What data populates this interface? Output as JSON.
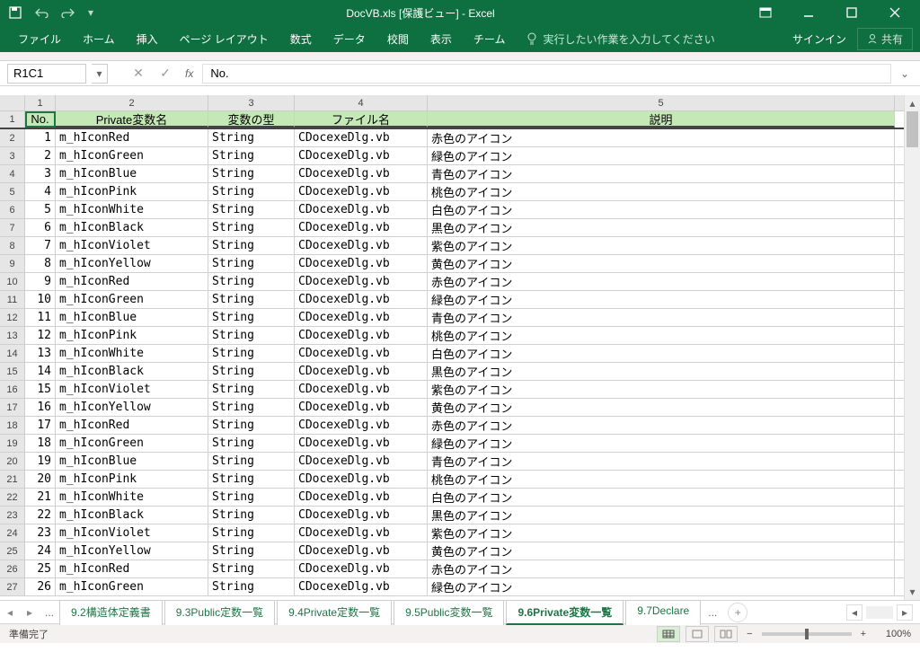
{
  "title_bar": {
    "app_title": "DocVB.xls  [保護ビュー] - Excel",
    "sign_in": "サインイン",
    "share": "共有"
  },
  "ribbon": {
    "tabs": [
      "ファイル",
      "ホーム",
      "挿入",
      "ページ レイアウト",
      "数式",
      "データ",
      "校閲",
      "表示",
      "チーム"
    ],
    "tell_me": "実行したい作業を入力してください"
  },
  "formula_bar": {
    "name_box": "R1C1",
    "formula": "No."
  },
  "grid": {
    "col_numbers": [
      "1",
      "2",
      "3",
      "4",
      "5"
    ],
    "headers": [
      "No.",
      "Private変数名",
      "変数の型",
      "ファイル名",
      "説明"
    ],
    "rows": [
      {
        "no": "1",
        "name": "m_hIconRed",
        "type": "String",
        "file": "CDocexeDlg.vb",
        "desc": "赤色のアイコン"
      },
      {
        "no": "2",
        "name": "m_hIconGreen",
        "type": "String",
        "file": "CDocexeDlg.vb",
        "desc": "緑色のアイコン"
      },
      {
        "no": "3",
        "name": "m_hIconBlue",
        "type": "String",
        "file": "CDocexeDlg.vb",
        "desc": "青色のアイコン"
      },
      {
        "no": "4",
        "name": "m_hIconPink",
        "type": "String",
        "file": "CDocexeDlg.vb",
        "desc": "桃色のアイコン"
      },
      {
        "no": "5",
        "name": "m_hIconWhite",
        "type": "String",
        "file": "CDocexeDlg.vb",
        "desc": "白色のアイコン"
      },
      {
        "no": "6",
        "name": "m_hIconBlack",
        "type": "String",
        "file": "CDocexeDlg.vb",
        "desc": "黒色のアイコン"
      },
      {
        "no": "7",
        "name": "m_hIconViolet",
        "type": "String",
        "file": "CDocexeDlg.vb",
        "desc": "紫色のアイコン"
      },
      {
        "no": "8",
        "name": "m_hIconYellow",
        "type": "String",
        "file": "CDocexeDlg.vb",
        "desc": "黄色のアイコン"
      },
      {
        "no": "9",
        "name": "m_hIconRed",
        "type": "String",
        "file": "CDocexeDlg.vb",
        "desc": "赤色のアイコン"
      },
      {
        "no": "10",
        "name": "m_hIconGreen",
        "type": "String",
        "file": "CDocexeDlg.vb",
        "desc": "緑色のアイコン"
      },
      {
        "no": "11",
        "name": "m_hIconBlue",
        "type": "String",
        "file": "CDocexeDlg.vb",
        "desc": "青色のアイコン"
      },
      {
        "no": "12",
        "name": "m_hIconPink",
        "type": "String",
        "file": "CDocexeDlg.vb",
        "desc": "桃色のアイコン"
      },
      {
        "no": "13",
        "name": "m_hIconWhite",
        "type": "String",
        "file": "CDocexeDlg.vb",
        "desc": "白色のアイコン"
      },
      {
        "no": "14",
        "name": "m_hIconBlack",
        "type": "String",
        "file": "CDocexeDlg.vb",
        "desc": "黒色のアイコン"
      },
      {
        "no": "15",
        "name": "m_hIconViolet",
        "type": "String",
        "file": "CDocexeDlg.vb",
        "desc": "紫色のアイコン"
      },
      {
        "no": "16",
        "name": "m_hIconYellow",
        "type": "String",
        "file": "CDocexeDlg.vb",
        "desc": "黄色のアイコン"
      },
      {
        "no": "17",
        "name": "m_hIconRed",
        "type": "String",
        "file": "CDocexeDlg.vb",
        "desc": "赤色のアイコン"
      },
      {
        "no": "18",
        "name": "m_hIconGreen",
        "type": "String",
        "file": "CDocexeDlg.vb",
        "desc": "緑色のアイコン"
      },
      {
        "no": "19",
        "name": "m_hIconBlue",
        "type": "String",
        "file": "CDocexeDlg.vb",
        "desc": "青色のアイコン"
      },
      {
        "no": "20",
        "name": "m_hIconPink",
        "type": "String",
        "file": "CDocexeDlg.vb",
        "desc": "桃色のアイコン"
      },
      {
        "no": "21",
        "name": "m_hIconWhite",
        "type": "String",
        "file": "CDocexeDlg.vb",
        "desc": "白色のアイコン"
      },
      {
        "no": "22",
        "name": "m_hIconBlack",
        "type": "String",
        "file": "CDocexeDlg.vb",
        "desc": "黒色のアイコン"
      },
      {
        "no": "23",
        "name": "m_hIconViolet",
        "type": "String",
        "file": "CDocexeDlg.vb",
        "desc": "紫色のアイコン"
      },
      {
        "no": "24",
        "name": "m_hIconYellow",
        "type": "String",
        "file": "CDocexeDlg.vb",
        "desc": "黄色のアイコン"
      },
      {
        "no": "25",
        "name": "m_hIconRed",
        "type": "String",
        "file": "CDocexeDlg.vb",
        "desc": "赤色のアイコン"
      },
      {
        "no": "26",
        "name": "m_hIconGreen",
        "type": "String",
        "file": "CDocexeDlg.vb",
        "desc": "緑色のアイコン"
      }
    ]
  },
  "sheets": {
    "tabs": [
      "9.2構造体定義書",
      "9.3Public定数一覧",
      "9.4Private定数一覧",
      "9.5Public変数一覧",
      "9.6Private変数一覧",
      "9.7Declare"
    ],
    "active_index": 4,
    "ellipsis_left": "...",
    "ellipsis_right": "..."
  },
  "status": {
    "ready": "準備完了",
    "zoom": "100%"
  }
}
